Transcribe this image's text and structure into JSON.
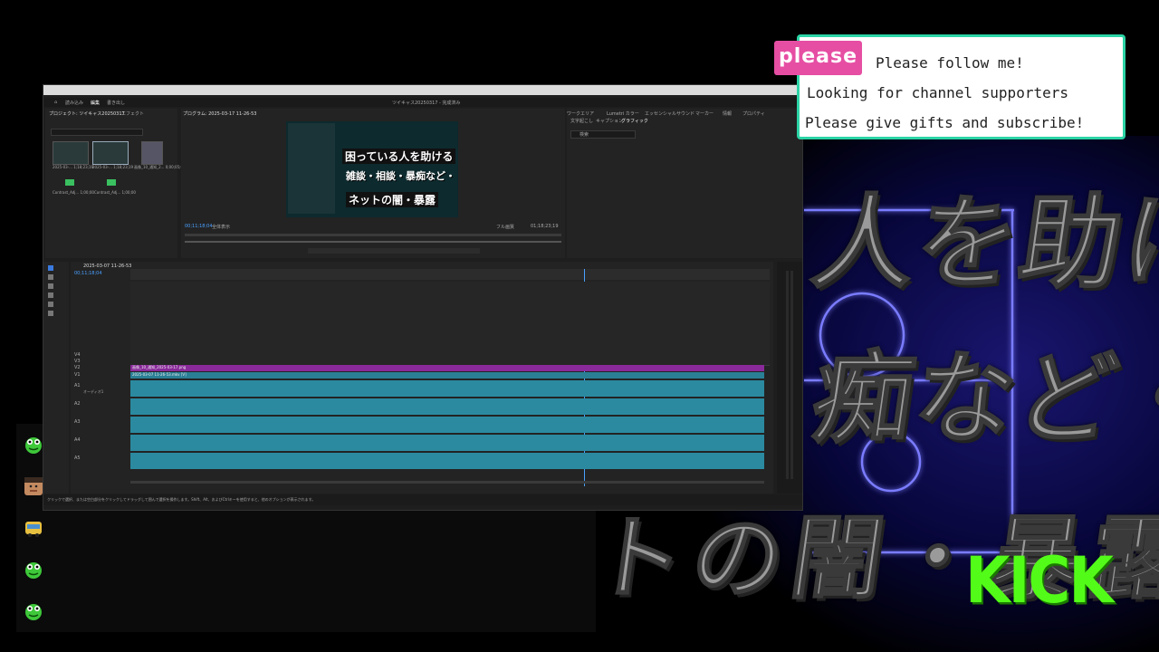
{
  "background": {
    "line1": "人を助ける",
    "line2": "痴など・・・",
    "line3": "ネットの闇・暴露"
  },
  "follow_panel": {
    "badge": "please",
    "line1": "Please follow me!",
    "line2": "Looking for channel supporters",
    "line3": "Please give gifts and subscribe!"
  },
  "kick_logo": "KICK",
  "editor": {
    "window_title": "ツイキャス20250317 - 完成済み",
    "menu": [
      "読み込み",
      "編集",
      "書き出し"
    ],
    "project_tab": "プロジェクト: ツイキャス20250317",
    "effects_tab": "エフェクト",
    "program_tab": "プログラム: 2025-03-17 11-26-53",
    "program_timecode": "00;11;18;04",
    "program_duration": "01;18;23;19",
    "fit_label": "全体表示",
    "full_label": "フル画質",
    "graphics_tabs": [
      "ワークエリア",
      "Lumetri カラー",
      "エッセンシャルサウンド",
      "マーカー",
      "情報",
      "プロパティ"
    ],
    "graphics_subtabs": [
      "文字起こし",
      "キャプション",
      "グラフィック"
    ],
    "graphics_search": "検索",
    "timeline_tab": "2025-03-07 11-26-53",
    "timeline_timecode": "00;11;18;04",
    "thumb_labels": [
      "2025-03-... 1;18;23;19",
      "2025-03-... 1;18;23;19",
      "画像_10_通知_2... 0;00;05;00",
      "Contrast_Adj... 1;00;00",
      "Contrast_Adj... 1;00;00"
    ],
    "video_tracks": [
      "V4",
      "V3",
      "V2",
      "V1"
    ],
    "audio_tracks": [
      "A1",
      "A2",
      "A3",
      "A4",
      "A5"
    ],
    "audio_label": "オーディオ1",
    "v2_clip": "画像_10_通知_2025-03-17.png",
    "v1_clip": "2025-03-07 11-26-53.mkv [V]",
    "status_text": "クリックで選択、または空白部分をクリックしてドラッグして囲んで選択を操作します。Shift、Alt、およびCtrlキーを使用すると、他のオプションが表示されます。"
  },
  "program_frame": {
    "headline1": "困っている人を助ける",
    "headline2": "雑談・相談・暴痴など・・・",
    "headline3": "ネットの闇・暴露"
  },
  "colors": {
    "accent_green": "#53fc18",
    "please_pink": "#e64ea3",
    "panel_border": "#2bd4a5",
    "neon_blue": "#3a3cff",
    "clip_purple": "#8a2a9a",
    "clip_teal": "#2b8aa0"
  }
}
